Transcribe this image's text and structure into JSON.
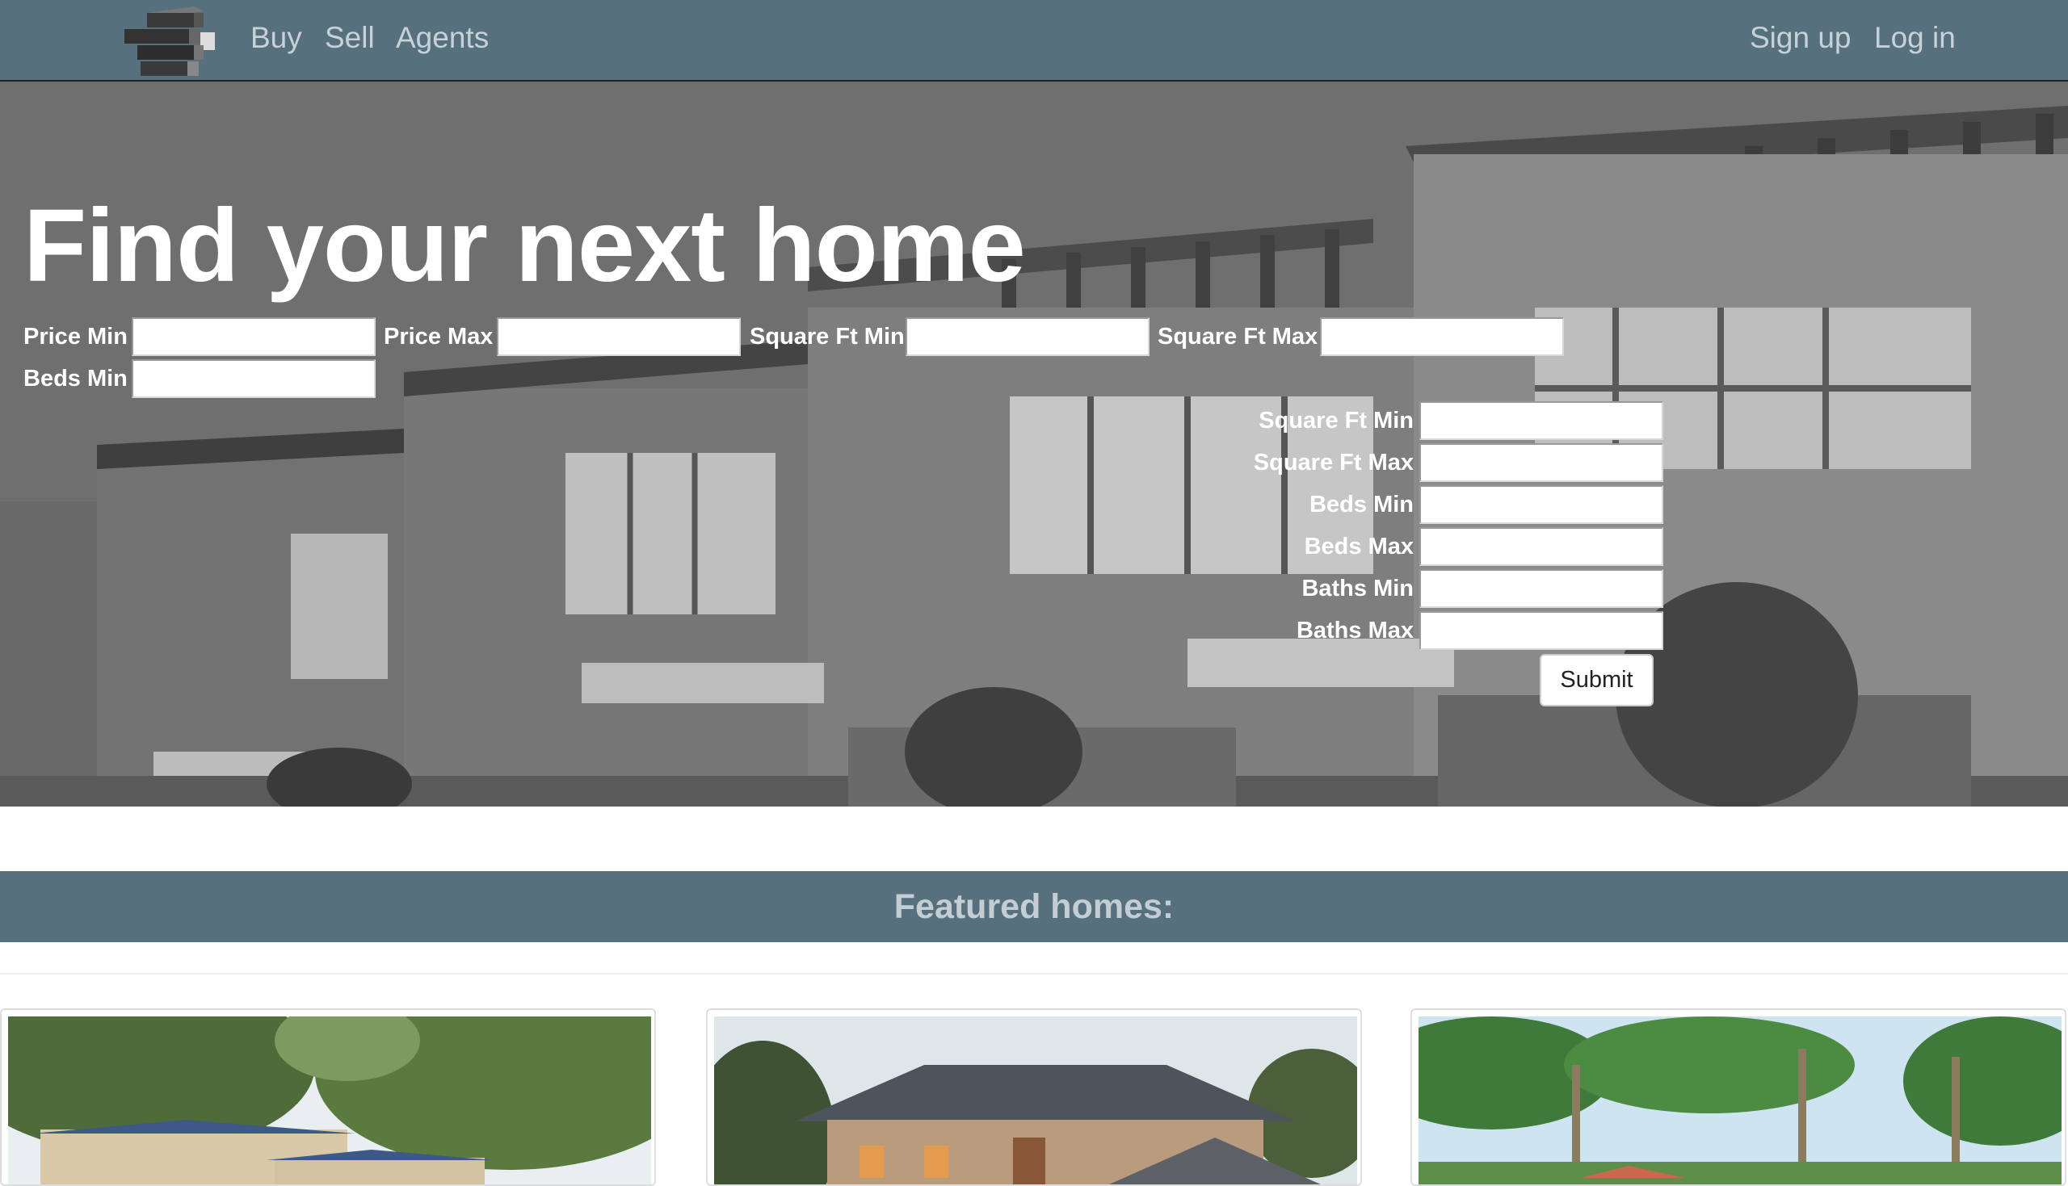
{
  "nav": {
    "links": [
      "Buy",
      "Sell",
      "Agents"
    ],
    "auth": [
      "Sign up",
      "Log in"
    ]
  },
  "hero": {
    "title": "Find your next home",
    "row_filters": [
      "Price Min",
      "Price Max",
      "Square Ft Min",
      "Square Ft Max",
      "Beds Min"
    ],
    "stack_filters": [
      "Square Ft Min",
      "Square Ft Max",
      "Beds Min",
      "Beds Max",
      "Baths Min",
      "Baths Max"
    ],
    "submit_label": "Submit"
  },
  "featured": {
    "heading": "Featured homes:"
  },
  "colors": {
    "navbar": "#56707e",
    "nav_text": "#c7d1d7",
    "featured_bar": "#56707e"
  },
  "icons": [
    "logo-blocks-icon"
  ]
}
